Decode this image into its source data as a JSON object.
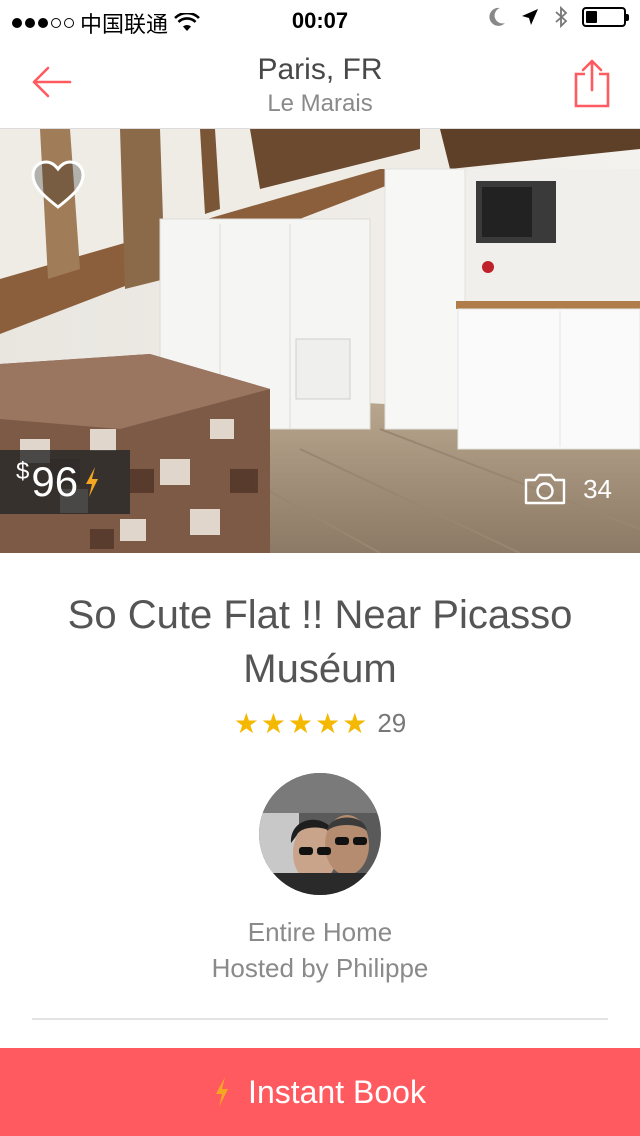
{
  "status_bar": {
    "carrier": "中国联通",
    "time": "00:07",
    "battery_level": 0.3
  },
  "nav": {
    "city": "Paris, FR",
    "neighborhood": "Le Marais",
    "back_icon": "back-arrow-icon",
    "share_icon": "share-icon"
  },
  "hero": {
    "price_currency": "$",
    "price_value": "96",
    "photo_count": "34",
    "favorite_icon": "heart-icon",
    "camera_icon": "camera-icon"
  },
  "listing": {
    "title": "So Cute Flat !! Near Picasso Muséum",
    "stars": 5,
    "review_count": "29",
    "room_type": "Entire Home",
    "host": "Hosted by Philippe"
  },
  "cta": {
    "label": "Instant Book"
  },
  "colors": {
    "brand": "#ff5a5f",
    "star": "#f5b800",
    "bolt": "#f5a623"
  }
}
